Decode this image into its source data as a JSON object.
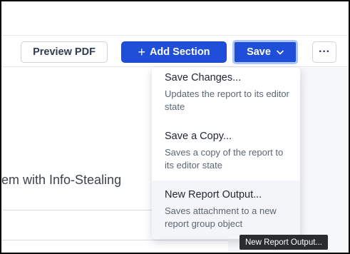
{
  "toolbar": {
    "preview_label": "Preview PDF",
    "add_section_label": "Add Section",
    "add_section_icon": "plus-icon",
    "save_label": "Save",
    "save_icon": "chevron-down-icon",
    "more_label": "···"
  },
  "document": {
    "title_fragment": "em with Info-Stealing"
  },
  "save_menu": {
    "items": [
      {
        "title": "Save Changes...",
        "description": "Updates the report to its editor state"
      },
      {
        "title": "Save a Copy...",
        "description": "Saves a copy of the report to its editor state"
      },
      {
        "title": "New Report Output...",
        "description": "Saves attachment to a new report group object"
      }
    ]
  },
  "tooltip": {
    "text": "New Report Output..."
  },
  "colors": {
    "primary": "#1f4fd8",
    "focus_ring": "#aec6f7",
    "tooltip_bg": "#2a2d30"
  }
}
